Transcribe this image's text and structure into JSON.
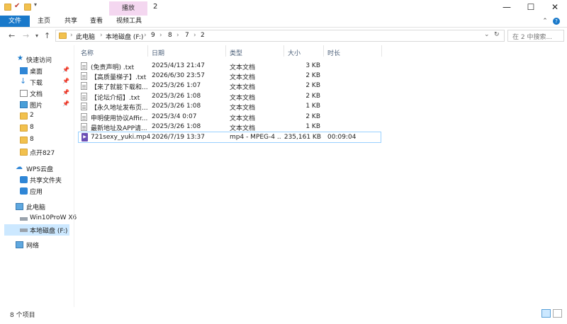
{
  "window": {
    "title": "2",
    "context_tab": "播放",
    "minimize": "—",
    "maximize": "☐",
    "close": "✕"
  },
  "ribbon": {
    "tabs": [
      "文件",
      "主页",
      "共享",
      "查看",
      "视频工具"
    ],
    "help": "⌃"
  },
  "address": {
    "breadcrumbs": [
      "此电脑",
      "本地磁盘 (F:)",
      "9",
      "8",
      "7",
      "2"
    ],
    "search_placeholder": "在 2 中搜索..."
  },
  "nav": {
    "quick_access": "快速访问",
    "pinned": [
      "桌面",
      "下载",
      "文档",
      "图片"
    ],
    "folders": [
      "2",
      "8",
      "8",
      "点开827"
    ],
    "wps": "WPS云盘",
    "wps_items": [
      "共享文件夹",
      "应用"
    ],
    "this_pc": "此电脑",
    "drives": [
      "Win10ProW X6",
      "本地磁盘 (F:)"
    ],
    "network": "网络"
  },
  "columns": {
    "name": "名称",
    "date": "日期",
    "type": "类型",
    "size": "大小",
    "length": "时长"
  },
  "files": [
    {
      "name": "(免责声明) .txt",
      "date": "2025/4/13 21:47",
      "type": "文本文档",
      "size": "3 KB",
      "length": ""
    },
    {
      "name": "【高质量梯子】.txt",
      "date": "2026/6/30 23:57",
      "type": "文本文档",
      "size": "2 KB",
      "length": ""
    },
    {
      "name": "【来了就能下载和...",
      "date": "2025/3/26 1:07",
      "type": "文本文档",
      "size": "2 KB",
      "length": ""
    },
    {
      "name": "【论坛介绍】.txt",
      "date": "2025/3/26 1:08",
      "type": "文本文档",
      "size": "2 KB",
      "length": ""
    },
    {
      "name": "【永久地址发布页...",
      "date": "2025/3/26 1:08",
      "type": "文本文档",
      "size": "1 KB",
      "length": ""
    },
    {
      "name": "申明使用协议Affir...",
      "date": "2025/3/4 0:07",
      "type": "文本文档",
      "size": "2 KB",
      "length": ""
    },
    {
      "name": "最新地址及APP请...",
      "date": "2025/3/26 1:08",
      "type": "文本文档",
      "size": "1 KB",
      "length": ""
    },
    {
      "name": "721sexy_yuki.mp4",
      "date": "2026/7/19 13:37",
      "type": "mp4 - MPEG-4 ...",
      "size": "235,161 KB",
      "length": "00:09:04"
    }
  ],
  "status": {
    "count": "8 个项目"
  }
}
